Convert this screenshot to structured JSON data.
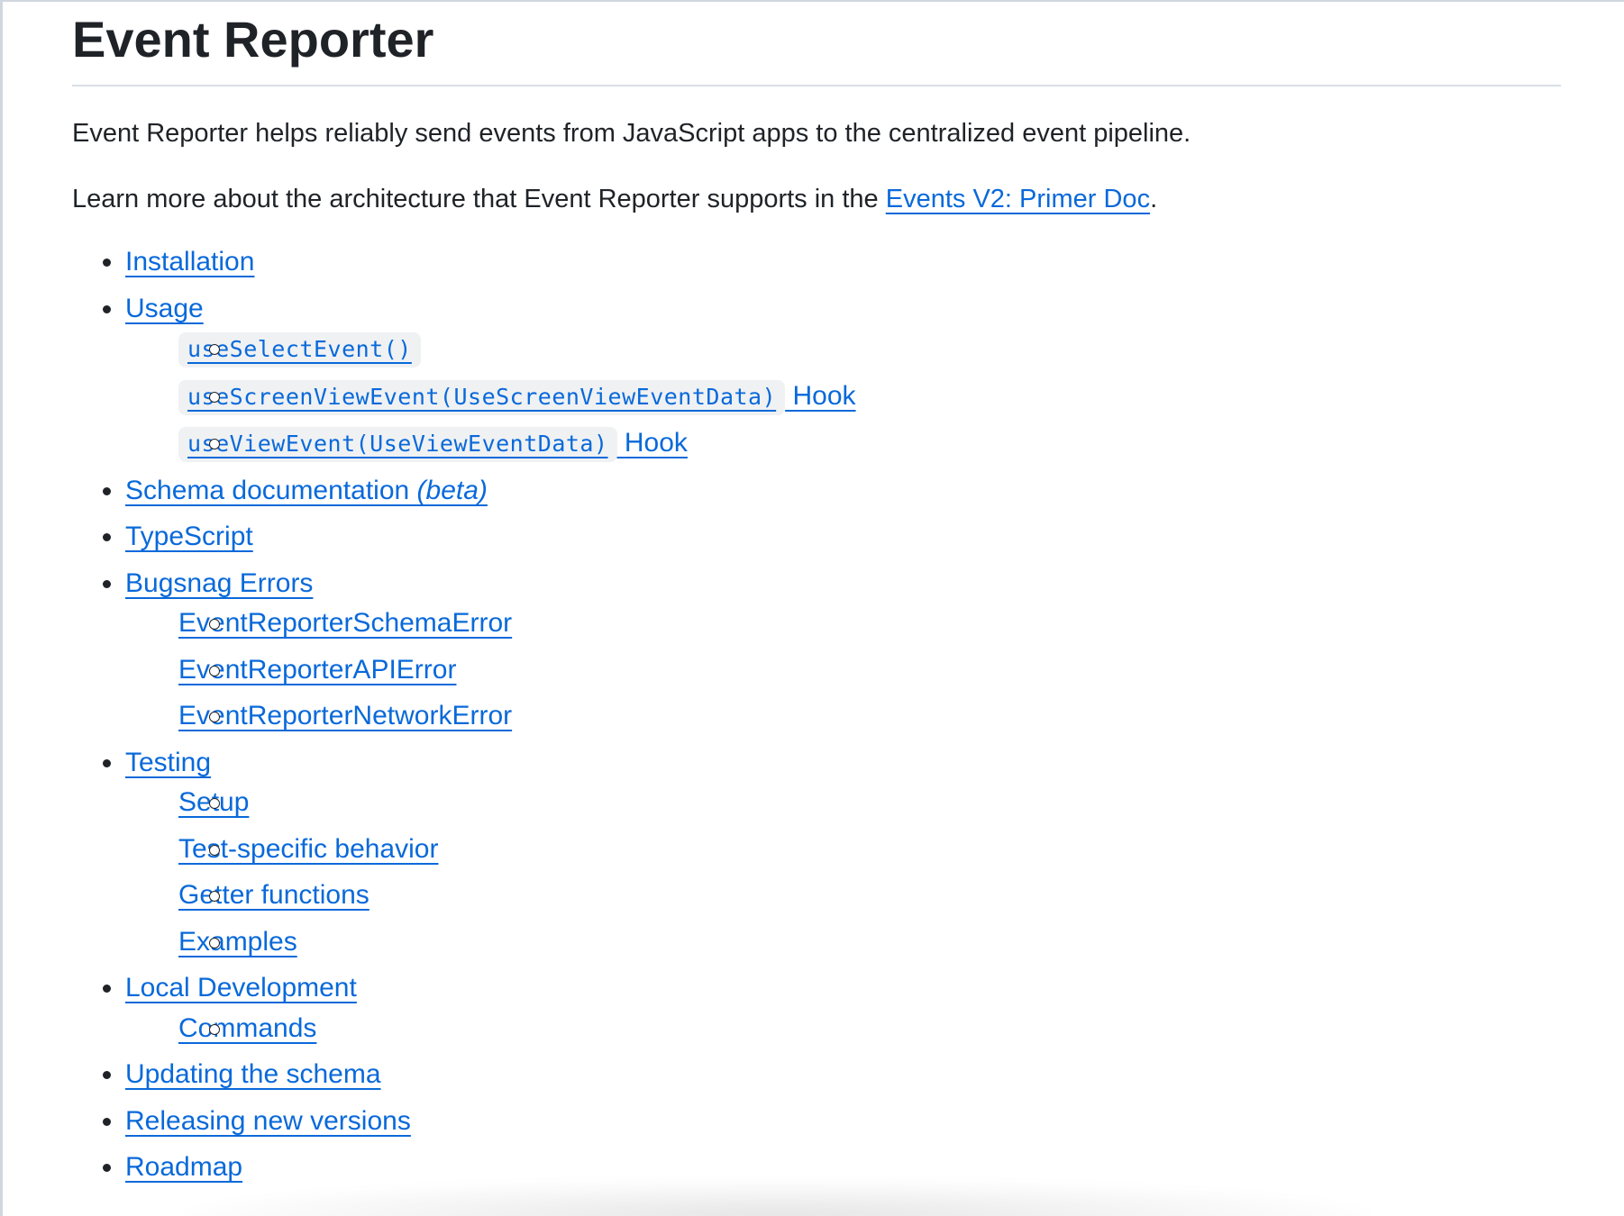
{
  "title": "Event Reporter",
  "intro": {
    "line1": "Event Reporter helps reliably send events from JavaScript apps to the centralized event pipeline.",
    "line2_prefix": "Learn more about the architecture that Event Reporter supports in the ",
    "line2_link": "Events V2: Primer Doc",
    "line2_suffix": "."
  },
  "toc": {
    "installation": "Installation",
    "usage": "Usage",
    "usage_items": {
      "select_event_code": "useSelectEvent()",
      "screen_view_code": "useScreenViewEvent(UseScreenViewEventData)",
      "screen_view_hook": "Hook",
      "view_event_code": "useViewEvent(UseViewEventData)",
      "view_event_hook": "Hook"
    },
    "schema_doc": "Schema documentation ",
    "schema_doc_beta": "(beta)",
    "typescript": "TypeScript",
    "bugsnag": "Bugsnag Errors",
    "bugsnag_items": [
      "EventReporterSchemaError",
      "EventReporterAPIError",
      "EventReporterNetworkError"
    ],
    "testing": "Testing",
    "testing_items": [
      "Setup",
      "Test-specific behavior",
      "Getter functions",
      "Examples"
    ],
    "local_dev": "Local Development",
    "local_dev_items": [
      "Commands"
    ],
    "updating_schema": "Updating the schema",
    "releasing": "Releasing new versions",
    "roadmap": "Roadmap"
  },
  "colors": {
    "link": "#0969da",
    "text": "#1f2328",
    "code_bg": "#eff1f3",
    "rule": "#d8dee4"
  }
}
